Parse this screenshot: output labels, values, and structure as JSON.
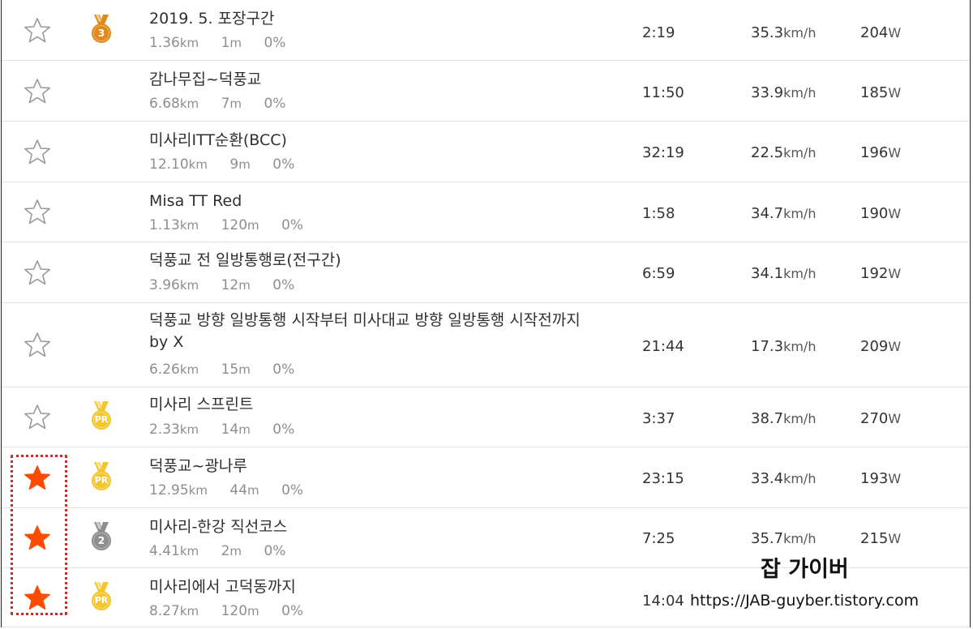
{
  "segments": [
    {
      "starred": false,
      "medal": "3",
      "medal_kind": "bronze",
      "name": "2019. 5. 포장구간",
      "distance": "1.36",
      "distance_unit": "km",
      "elevation": "1",
      "elevation_unit": "m",
      "grade": "0%",
      "time": "2:19",
      "speed": "35.3",
      "speed_unit": "km/h",
      "power": "204",
      "power_unit": "W"
    },
    {
      "starred": false,
      "medal": "",
      "medal_kind": "none",
      "name": "감나무집~덕풍교",
      "distance": "6.68",
      "distance_unit": "km",
      "elevation": "7",
      "elevation_unit": "m",
      "grade": "0%",
      "time": "11:50",
      "speed": "33.9",
      "speed_unit": "km/h",
      "power": "185",
      "power_unit": "W"
    },
    {
      "starred": false,
      "medal": "",
      "medal_kind": "none",
      "name": "미사리ITT순환(BCC)",
      "distance": "12.10",
      "distance_unit": "km",
      "elevation": "9",
      "elevation_unit": "m",
      "grade": "0%",
      "time": "32:19",
      "speed": "22.5",
      "speed_unit": "km/h",
      "power": "196",
      "power_unit": "W"
    },
    {
      "starred": false,
      "medal": "",
      "medal_kind": "none",
      "name": "Misa TT Red",
      "distance": "1.13",
      "distance_unit": "km",
      "elevation": "120",
      "elevation_unit": "m",
      "grade": "0%",
      "time": "1:58",
      "speed": "34.7",
      "speed_unit": "km/h",
      "power": "190",
      "power_unit": "W"
    },
    {
      "starred": false,
      "medal": "",
      "medal_kind": "none",
      "name": "덕풍교 전 일방통행로(전구간)",
      "distance": "3.96",
      "distance_unit": "km",
      "elevation": "12",
      "elevation_unit": "m",
      "grade": "0%",
      "time": "6:59",
      "speed": "34.1",
      "speed_unit": "km/h",
      "power": "192",
      "power_unit": "W"
    },
    {
      "starred": false,
      "medal": "",
      "medal_kind": "none",
      "name": "덕풍교 방향 일방통행 시작부터 미사대교 방향 일방통행 시작전까지 by X",
      "distance": "6.26",
      "distance_unit": "km",
      "elevation": "15",
      "elevation_unit": "m",
      "grade": "0%",
      "time": "21:44",
      "speed": "17.3",
      "speed_unit": "km/h",
      "power": "209",
      "power_unit": "W"
    },
    {
      "starred": false,
      "medal": "PR",
      "medal_kind": "gold",
      "name": "미사리 스프린트",
      "distance": "2.33",
      "distance_unit": "km",
      "elevation": "14",
      "elevation_unit": "m",
      "grade": "0%",
      "time": "3:37",
      "speed": "38.7",
      "speed_unit": "km/h",
      "power": "270",
      "power_unit": "W"
    },
    {
      "starred": true,
      "medal": "PR",
      "medal_kind": "gold",
      "name": "덕풍교~광나루",
      "distance": "12.95",
      "distance_unit": "km",
      "elevation": "44",
      "elevation_unit": "m",
      "grade": "0%",
      "time": "23:15",
      "speed": "33.4",
      "speed_unit": "km/h",
      "power": "193",
      "power_unit": "W"
    },
    {
      "starred": true,
      "medal": "2",
      "medal_kind": "silver",
      "name": "미사리-한강 직선코스",
      "distance": "4.41",
      "distance_unit": "km",
      "elevation": "2",
      "elevation_unit": "m",
      "grade": "0%",
      "time": "7:25",
      "speed": "35.7",
      "speed_unit": "km/h",
      "power": "215",
      "power_unit": "W"
    },
    {
      "starred": true,
      "medal": "PR",
      "medal_kind": "gold",
      "name": "미사리에서 고덕동까지",
      "distance": "8.27",
      "distance_unit": "km",
      "elevation": "120",
      "elevation_unit": "m",
      "grade": "0%",
      "time": "14:04",
      "speed": "",
      "speed_unit": "",
      "power": "",
      "power_unit": ""
    }
  ],
  "colors": {
    "star_active": "#fc4c02",
    "star_inactive": "#9a9a9a",
    "medal_gold": "#f4c62d",
    "medal_bronze": "#e08a1b",
    "medal_silver": "#8e8e8e",
    "highlight_border": "#c22e2e"
  },
  "watermark": {
    "title": "잡 가이버",
    "url": "https://JAB-guyber.tistory.com"
  }
}
